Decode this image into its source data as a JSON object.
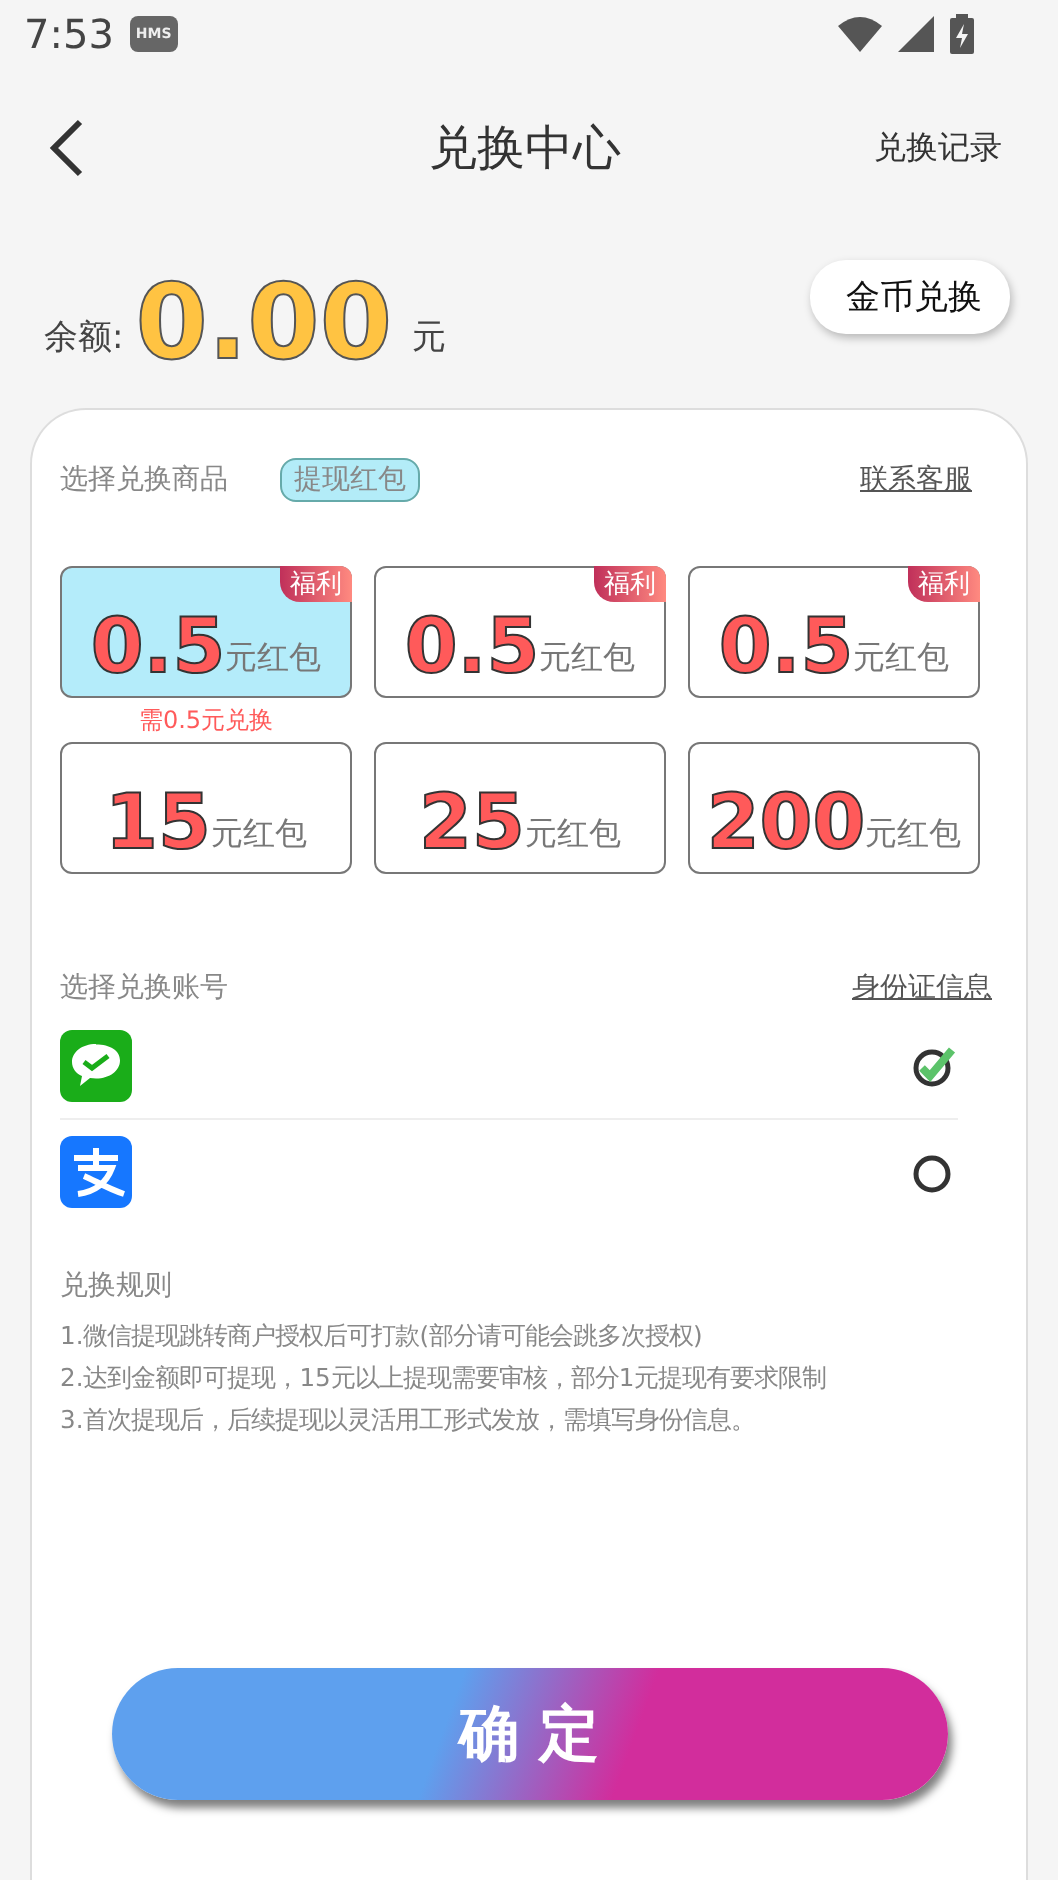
{
  "status_bar": {
    "time": "7:53",
    "badge": "HMS"
  },
  "header": {
    "title": "兑换中心",
    "action": "兑换记录"
  },
  "balance": {
    "label": "余额:",
    "amount": "0.00",
    "unit": "元",
    "button": "金币兑换"
  },
  "products": {
    "label": "选择兑换商品",
    "tag": "提现红包",
    "link": "联系客服",
    "items": [
      {
        "amount": "0.5",
        "unit": "元红包",
        "badge": "福利",
        "selected": true,
        "note": "需0.5元兑换"
      },
      {
        "amount": "0.5",
        "unit": "元红包",
        "badge": "福利",
        "selected": false
      },
      {
        "amount": "0.5",
        "unit": "元红包",
        "badge": "福利",
        "selected": false
      },
      {
        "amount": "15",
        "unit": "元红包",
        "selected": false
      },
      {
        "amount": "25",
        "unit": "元红包",
        "selected": false
      },
      {
        "amount": "200",
        "unit": "元红包",
        "selected": false
      }
    ]
  },
  "accounts": {
    "label": "选择兑换账号",
    "link": "身份证信息",
    "items": [
      {
        "kind": "wechat",
        "selected": true
      },
      {
        "kind": "alipay",
        "selected": false
      }
    ]
  },
  "rules": {
    "title": "兑换规则",
    "lines": [
      "1.微信提现跳转商户授权后可打款(部分请可能会跳多次授权)",
      "2.达到金额即可提现，15元以上提现需要审核，部分1元提现有要求限制",
      "3.首次提现后，后续提现以灵活用工形式发放，需填写身份信息。"
    ]
  },
  "confirm": {
    "label": "确 定"
  }
}
